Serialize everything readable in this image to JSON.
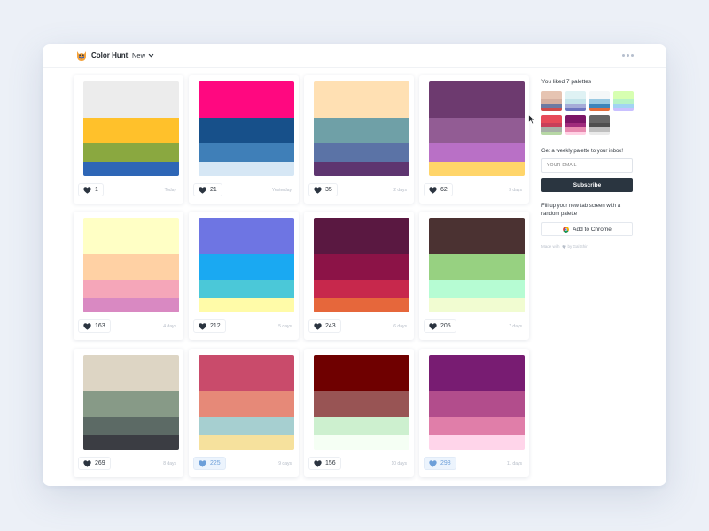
{
  "header": {
    "brand": "Color Hunt",
    "nav_label": "New"
  },
  "palettes": [
    {
      "colors": [
        "#ececec",
        "#ffc12b",
        "#8aa840",
        "#2e66b6"
      ],
      "likes": "1",
      "date": "Today",
      "liked": false
    },
    {
      "colors": [
        "#ff0880",
        "#17508a",
        "#3f7fb8",
        "#d6e7f5"
      ],
      "likes": "21",
      "date": "Yesterday",
      "liked": false
    },
    {
      "colors": [
        "#ffe0b3",
        "#6fa0a7",
        "#5b73a6",
        "#5e3570"
      ],
      "likes": "35",
      "date": "2 days",
      "liked": false
    },
    {
      "colors": [
        "#6d3a6f",
        "#925c94",
        "#b970c6",
        "#ffd56a"
      ],
      "likes": "62",
      "date": "3 days",
      "liked": false
    },
    {
      "colors": [
        "#ffffc5",
        "#ffd1a4",
        "#f5a6b9",
        "#d989c2"
      ],
      "likes": "163",
      "date": "4 days",
      "liked": false
    },
    {
      "colors": [
        "#6e75e3",
        "#1aa9f2",
        "#4bc8d8",
        "#fffba8"
      ],
      "likes": "212",
      "date": "5 days",
      "liked": false
    },
    {
      "colors": [
        "#5a1841",
        "#8c1347",
        "#c7284c",
        "#e6673b"
      ],
      "likes": "243",
      "date": "6 days",
      "liked": false
    },
    {
      "colors": [
        "#4b3232",
        "#97d181",
        "#b6fcd3",
        "#f1fcd1"
      ],
      "likes": "205",
      "date": "7 days",
      "liked": false
    },
    {
      "colors": [
        "#ddd5c4",
        "#879a87",
        "#5c6a65",
        "#3b3d43"
      ],
      "likes": "269",
      "date": "8 days",
      "liked": false
    },
    {
      "colors": [
        "#c94b6b",
        "#e68978",
        "#a6cfd0",
        "#f6e19d"
      ],
      "likes": "225",
      "date": "9 days",
      "liked": true
    },
    {
      "colors": [
        "#6f0000",
        "#985454",
        "#cdf0cf",
        "#f5fff4"
      ],
      "likes": "156",
      "date": "10 days",
      "liked": false
    },
    {
      "colors": [
        "#781c72",
        "#b24d8c",
        "#e07ea9",
        "#ffd5ea"
      ],
      "likes": "298",
      "date": "11 days",
      "liked": true
    }
  ],
  "sidebar": {
    "liked_title": "You liked 7 palettes",
    "liked_palettes": [
      [
        "#e6c4b2",
        "#d5b0a1",
        "#6c7aa2",
        "#cf4b4b"
      ],
      [
        "#dff2f4",
        "#c4e4ea",
        "#a6acd8",
        "#6d75c0"
      ],
      [
        "#f4f7f8",
        "#9ac9e2",
        "#3e84ba",
        "#e36c3c"
      ],
      [
        "#d7ffb1",
        "#b7f3c6",
        "#a2d4f3",
        "#c9c0ff"
      ],
      [
        "#e74a59",
        "#c83f5a",
        "#a8b0a8",
        "#b7d8a5"
      ],
      [
        "#7b1566",
        "#a02b7c",
        "#e88ab0",
        "#ffd1e4"
      ],
      [
        "#666666",
        "#4f4f4f",
        "#bfbfbf",
        "#eaeaea"
      ]
    ],
    "weekly_text": "Get a weekly palette to your inbox!",
    "email_placeholder": "YOUR EMAIL",
    "subscribe_label": "Subscribe",
    "fillup_text": "Fill up your new tab screen with a random palette",
    "chrome_label": "Add to Chrome",
    "made_with_prefix": "Made with",
    "made_with_suffix": "by Gal Shir"
  },
  "colors": {
    "accent_dark": "#2a3540",
    "liked_heart": "#6c9fd9",
    "heart": "#2b3440"
  }
}
